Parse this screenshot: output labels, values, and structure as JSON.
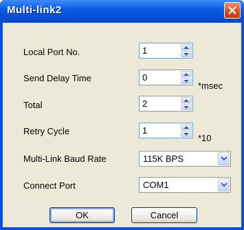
{
  "window": {
    "title": "Multi-link2"
  },
  "fields": {
    "local_port": {
      "label": "Local Port No.",
      "value": "1"
    },
    "send_delay": {
      "label": "Send Delay Time",
      "value": "0",
      "unit": "*msec"
    },
    "total": {
      "label": "Total",
      "value": "2"
    },
    "retry_cycle": {
      "label": "Retry Cycle",
      "value": "1",
      "unit": "*10"
    },
    "baud_rate": {
      "label": "Multi-Link Baud Rate",
      "value": "115K BPS"
    },
    "connect_port": {
      "label": "Connect Port",
      "value": "COM1"
    }
  },
  "buttons": {
    "ok": "OK",
    "cancel": "Cancel"
  },
  "icons": {
    "close": "close-icon",
    "spin_up": "arrow-up-icon",
    "spin_down": "arrow-down-icon",
    "dropdown": "chevron-down-icon"
  },
  "colors": {
    "titlebar": "#0a55e0",
    "close": "#d9481e",
    "client": "#ece9d8",
    "field_border": "#7f9db9"
  }
}
